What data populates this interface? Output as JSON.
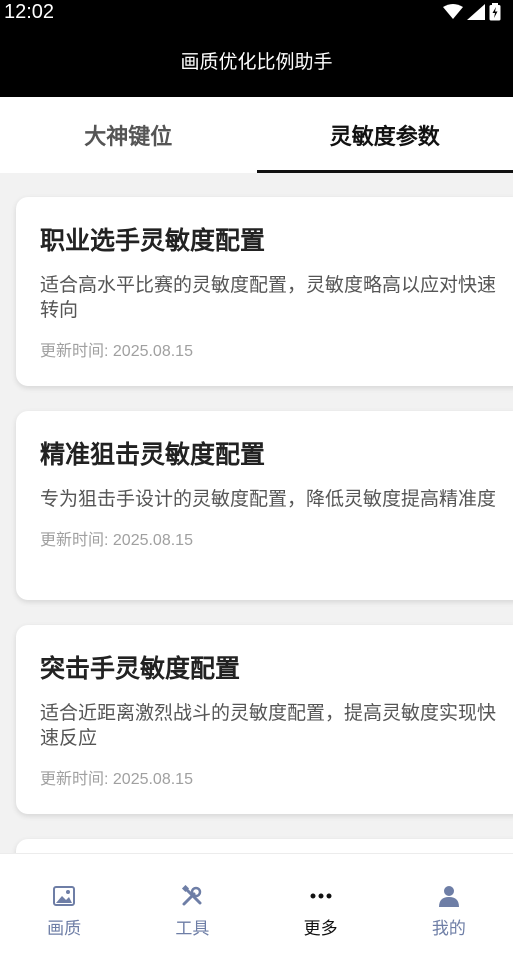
{
  "status": {
    "time": "12:02"
  },
  "appbar": {
    "title": "画质优化比例助手"
  },
  "tabs": [
    {
      "label": "大神键位",
      "active": false
    },
    {
      "label": "灵敏度参数",
      "active": true
    }
  ],
  "cards": [
    {
      "title": "职业选手灵敏度配置",
      "desc": "适合高水平比赛的灵敏度配置，灵敏度略高以应对快速转向",
      "date": "更新时间: 2025.08.15"
    },
    {
      "title": "精准狙击灵敏度配置",
      "desc": "专为狙击手设计的灵敏度配置，降低灵敏度提高精准度",
      "date": "更新时间: 2025.08.15"
    },
    {
      "title": "突击手灵敏度配置",
      "desc": "适合近距离激烈战斗的灵敏度配置，提高灵敏度实现快速反应",
      "date": "更新时间: 2025.08.15"
    }
  ],
  "nav": [
    {
      "label": "画质",
      "icon": "image-icon"
    },
    {
      "label": "工具",
      "icon": "tools-icon"
    },
    {
      "label": "更多",
      "icon": "more-icon",
      "active": true
    },
    {
      "label": "我的",
      "icon": "person-icon"
    }
  ],
  "colors": {
    "nav_inactive": "#6e7ea6",
    "nav_active": "#111111",
    "appbar": "#000000"
  }
}
